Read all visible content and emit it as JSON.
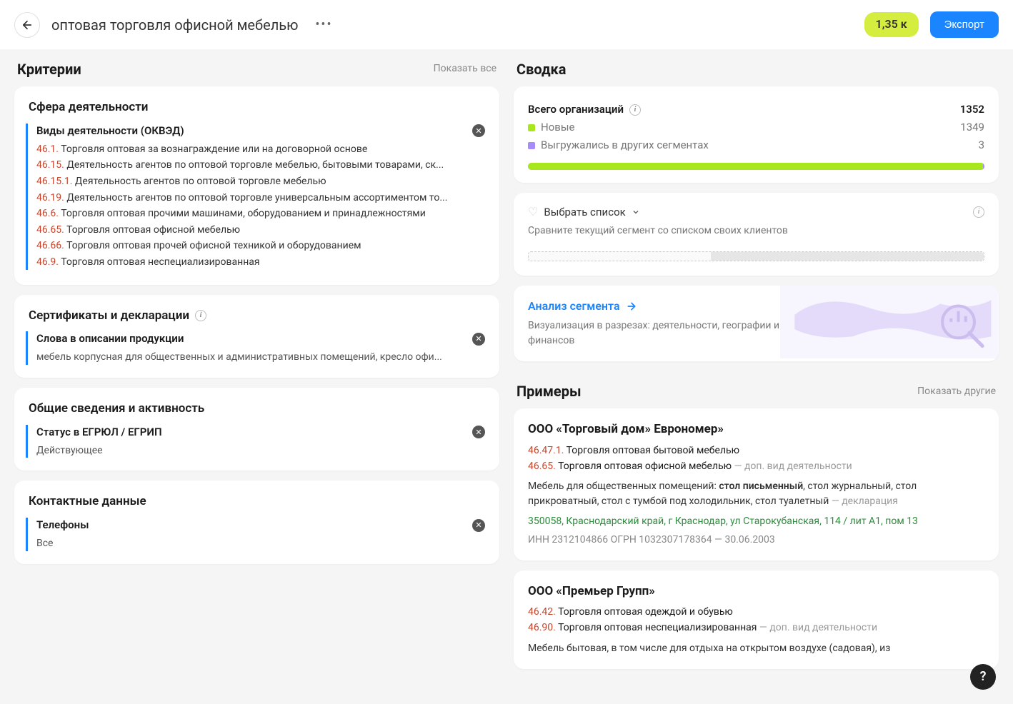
{
  "header": {
    "title": "оптовая торговля офисной мебелью",
    "count_badge": "1,35 к",
    "export_label": "Экспорт"
  },
  "criteria": {
    "heading": "Критерии",
    "show_all": "Показать все",
    "sections": [
      {
        "title": "Сфера деятельности",
        "blocks": [
          {
            "title": "Виды деятельности (ОКВЭД)",
            "okved": [
              {
                "code": "46.1.",
                "text": "Торговля оптовая за вознаграждение или на договорной основе"
              },
              {
                "code": "46.15.",
                "text": "Деятельность агентов по оптовой торговле мебелью, бытовыми товарами, ск..."
              },
              {
                "code": "46.15.1.",
                "text": "Деятельность агентов по оптовой торговле мебелью"
              },
              {
                "code": "46.19.",
                "text": "Деятельность агентов по оптовой торговле универсальным ассортиментом то..."
              },
              {
                "code": "46.6.",
                "text": "Торговля оптовая прочими машинами, оборудованием и принадлежностями"
              },
              {
                "code": "46.65.",
                "text": "Торговля оптовая офисной мебелью"
              },
              {
                "code": "46.66.",
                "text": "Торговля оптовая прочей офисной техникой и оборудованием"
              },
              {
                "code": "46.9.",
                "text": "Торговля оптовая неспециализированная"
              }
            ]
          }
        ]
      },
      {
        "title": "Сертификаты и декларации",
        "has_info": true,
        "blocks": [
          {
            "title": "Слова в описании продукции",
            "value": "мебель корпусная для общественных и административных помещений, кресло офи..."
          }
        ]
      },
      {
        "title": "Общие сведения и активность",
        "blocks": [
          {
            "title": "Статус в ЕГРЮЛ / ЕГРИП",
            "value": "Действующее"
          }
        ]
      },
      {
        "title": "Контактные данные",
        "blocks": [
          {
            "title": "Телефоны",
            "value": "Все"
          }
        ]
      }
    ]
  },
  "summary": {
    "heading": "Сводка",
    "total_label": "Всего организаций",
    "total_value": "1352",
    "new_label": "Новые",
    "new_value": "1349",
    "exported_label": "Выгружались в других сегментах",
    "exported_value": "3",
    "select_list": {
      "trigger": "Выбрать список",
      "desc": "Сравните текущий сегмент со списком своих клиентов"
    },
    "analysis": {
      "link": "Анализ сегмента",
      "desc": "Визуализация в разрезах: деятельности, географии и финансов"
    }
  },
  "examples": {
    "heading": "Примеры",
    "show_other": "Показать другие",
    "items": [
      {
        "name": "ООО «Торговый дом» Еврономер»",
        "okved": [
          {
            "code": "46.47.1.",
            "text": "Торговля оптовая бытовой мебелью",
            "suffix": ""
          },
          {
            "code": "46.65.",
            "text": "Торговля оптовая офисной мебелью",
            "suffix": " — доп. вид деятельности"
          }
        ],
        "desc_prefix": "Мебель для общественных помещений: ",
        "desc_bold": "стол письменный",
        "desc_mid": ", стол ",
        "desc_rest": "журнальный, стол прикроватный, стол с тумбой под холодильник, стол туалетный",
        "desc_suffix": " — декларация",
        "address": "350058, Краснодарский край, г Краснодар, ул Старокубанская, 114 / лит А1, пом 13",
        "meta": "ИНН 2312104866   ОГРН 1032307178364 — 30.06.2003"
      },
      {
        "name": "ООО «Премьер Групп»",
        "okved": [
          {
            "code": "46.42.",
            "text": "Торговля оптовая одеждой и обувью",
            "suffix": ""
          },
          {
            "code": "46.90.",
            "text": "Торговля оптовая неспециализированная",
            "suffix": " — доп. вид деятельности"
          }
        ],
        "desc_prefix": "Мебель бытовая, в том числе для отдыха на открытом воздухе (садовая), из",
        "desc_bold": "",
        "desc_mid": "",
        "desc_rest": "",
        "desc_suffix": "",
        "address": "",
        "meta": ""
      }
    ]
  },
  "help_label": "?"
}
